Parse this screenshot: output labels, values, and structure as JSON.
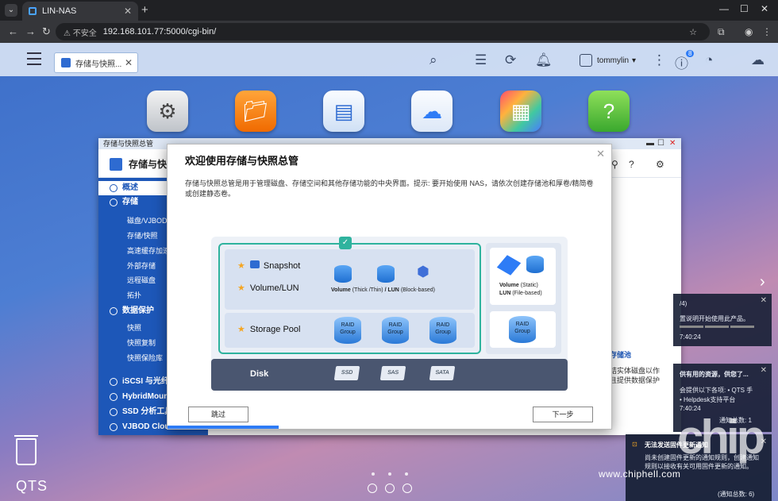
{
  "browser": {
    "tab_title": "LIN-NAS",
    "insecure_label": "不安全",
    "url": "192.168.101.77:5000/cgi-bin/"
  },
  "qts": {
    "tab_title": "存储与快照...",
    "username": "tommylin",
    "notif_count": "8",
    "brand": "QTS"
  },
  "storage_window": {
    "title": "存储与快照总管",
    "app_name": "存储与快照",
    "sidebar": [
      {
        "label": "概述",
        "type": "main",
        "selected": true
      },
      {
        "label": "存储",
        "type": "main"
      },
      {
        "label": "磁盘/VJBOD",
        "type": "sub"
      },
      {
        "label": "存储/快照",
        "type": "sub"
      },
      {
        "label": "高速缓存加速",
        "type": "sub"
      },
      {
        "label": "外部存储",
        "type": "sub"
      },
      {
        "label": "远程磁盘",
        "type": "sub"
      },
      {
        "label": "拓扑",
        "type": "sub"
      },
      {
        "label": "数据保护",
        "type": "main"
      },
      {
        "label": "快照",
        "type": "sub"
      },
      {
        "label": "快照复制",
        "type": "sub"
      },
      {
        "label": "快照保险库",
        "type": "sub"
      },
      {
        "label": "iSCSI 与光纤通",
        "type": "main"
      },
      {
        "label": "HybridMount",
        "type": "main"
      },
      {
        "label": "SSD 分析工具",
        "type": "main"
      },
      {
        "label": "VJBOD Cloud",
        "type": "main"
      }
    ],
    "right_hint": [
      "存储池",
      "结实体磁盘以作",
      "且提供数据保护"
    ]
  },
  "modal": {
    "title": "欢迎使用存储与快照总管",
    "description": "存储与快照总管是用于管理磁盘、存储空间和其他存储功能的中央界面。提示: 要开始使用 NAS，请依次创建存储池和厚卷/精简卷或创建静态卷。",
    "snapshot_label": "Snapshot",
    "volume_lun_label": "Volume/LUN",
    "storage_pool_label": "Storage Pool",
    "disk_label": "Disk",
    "volume_text": "Volume",
    "volume_types": "(Thick /Thin)",
    "lun_text": "/ LUN",
    "lun_type": "(Block-based)",
    "static_volume": "Volume",
    "static_volume_type": "(Static)",
    "lun_file": "LUN",
    "lun_file_type": "(File-based)",
    "raid_label": "RAID",
    "group_label": "Group",
    "disk_types": [
      "SSD",
      "SAS",
      "SATA"
    ],
    "skip_button": "跳过",
    "next_button": "下一步",
    "progress_fraction": 0.25
  },
  "notifications": [
    {
      "lines": [
        "/4)",
        "置说明开始使用此产品。",
        "7:40:24"
      ]
    },
    {
      "lines": [
        "供有用的资源，供您了...",
        "会提供以下各项: • QTS 手",
        "• Helpdesk支持平台",
        "7:40:24",
        "通知总数: 1"
      ]
    }
  ],
  "notification_bottom": {
    "title": "无法发送固件更新通知",
    "body": "尚未创建固件更新的通知规则，创建通知规则以接收有关可用固件更新的通知。",
    "count": "(通知总数: 6)"
  },
  "watermark": {
    "site": "www.chiphell.com",
    "big": "chip"
  }
}
